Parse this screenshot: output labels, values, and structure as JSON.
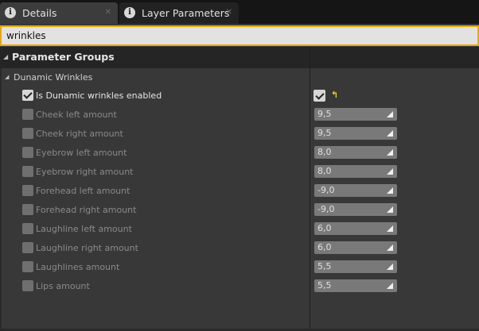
{
  "tabs": [
    {
      "label": "Details",
      "icon": "info-icon"
    },
    {
      "label": "Layer Parameters",
      "icon": "info-icon"
    }
  ],
  "search": {
    "value": "wrinkles"
  },
  "group_header": {
    "title": "Parameter Groups"
  },
  "category": {
    "label": "Dunamic Wrinkles"
  },
  "params": [
    {
      "label": "Is Dunamic wrinkles enabled",
      "value": "",
      "enabled": true
    },
    {
      "label": "Cheek left amount",
      "value": "9,5",
      "enabled": false
    },
    {
      "label": "Cheek right amount",
      "value": "9,5",
      "enabled": false
    },
    {
      "label": "Eyebrow left amount",
      "value": "8,0",
      "enabled": false
    },
    {
      "label": "Eyebrow right amount",
      "value": "8,0",
      "enabled": false
    },
    {
      "label": "Forehead left amount",
      "value": "-9,0",
      "enabled": false
    },
    {
      "label": "Forehead right amount",
      "value": "-9,0",
      "enabled": false
    },
    {
      "label": "Laughline left amount",
      "value": "6,0",
      "enabled": false
    },
    {
      "label": "Laughline right amount",
      "value": "6,0",
      "enabled": false
    },
    {
      "label": "Laughlines amount",
      "value": "5,5",
      "enabled": false
    },
    {
      "label": "Lips amount",
      "value": "5,5",
      "enabled": false
    }
  ],
  "colors": {
    "accent": "#e8a80c",
    "panel": "#383838",
    "reset_arrow": "#e8d220"
  }
}
